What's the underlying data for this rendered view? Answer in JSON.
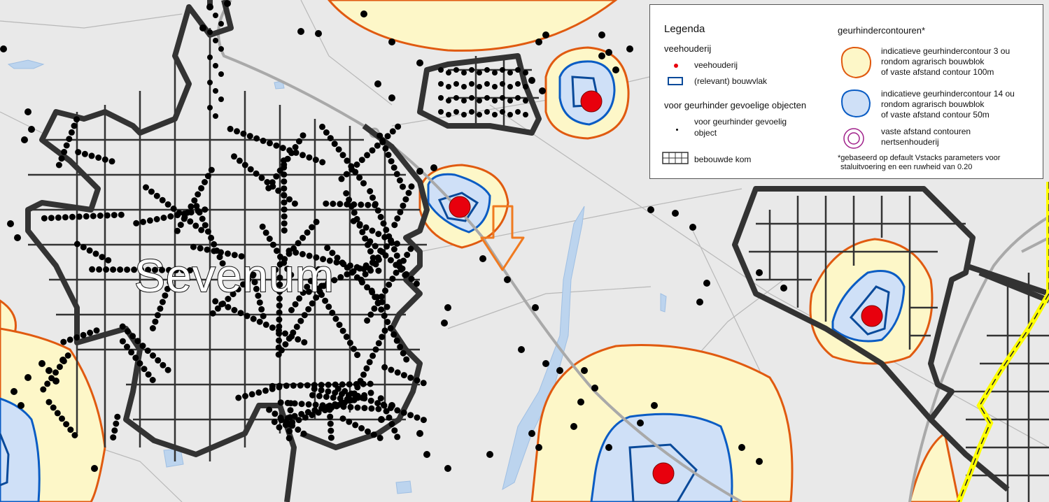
{
  "map": {
    "place_label": "Sevenum",
    "colors": {
      "background": "#e9e9e9",
      "contour_3_fill": "#fdf7c8",
      "contour_3_stroke": "#e05a10",
      "contour_14_fill": "#cfe0f7",
      "contour_14_stroke": "#0a5cc4",
      "livestock_point": "#e8000d",
      "sensitive_object": "#000000",
      "built_area_outline": "#333333",
      "road": "#a9a9a9",
      "water": "#bcd4ee",
      "boundary": "#ffff00",
      "arrow": "#f07a20"
    },
    "icons": [
      "arrow-down-icon"
    ]
  },
  "legend": {
    "title": "Legenda",
    "group_livestock": {
      "heading": "veehouderij",
      "items": [
        "veehouderij",
        "(relevant) bouwvlak"
      ]
    },
    "group_sensitive": {
      "heading": "voor geurhinder gevoelige objecten",
      "item_line1": "voor geurhinder gevoelig",
      "item_line2": "object"
    },
    "built_area": "bebouwde kom",
    "group_contours": {
      "heading": "geurhindercontouren*",
      "contour3": [
        "indicatieve geurhindercontour 3 ou",
        "rondom agrarisch bouwblok",
        "of vaste afstand contour 100m"
      ],
      "contour14": [
        "indicatieve geurhindercontour 14 ou",
        "rondom agrarisch bouwblok",
        "of vaste afstand contour 50m"
      ],
      "mink": [
        "vaste afstand contouren",
        "nertsenhouderij"
      ]
    },
    "note": [
      "*gebaseerd op default Vstacks parameters voor",
      "staluitvoering en een ruwheid van 0.20"
    ]
  }
}
